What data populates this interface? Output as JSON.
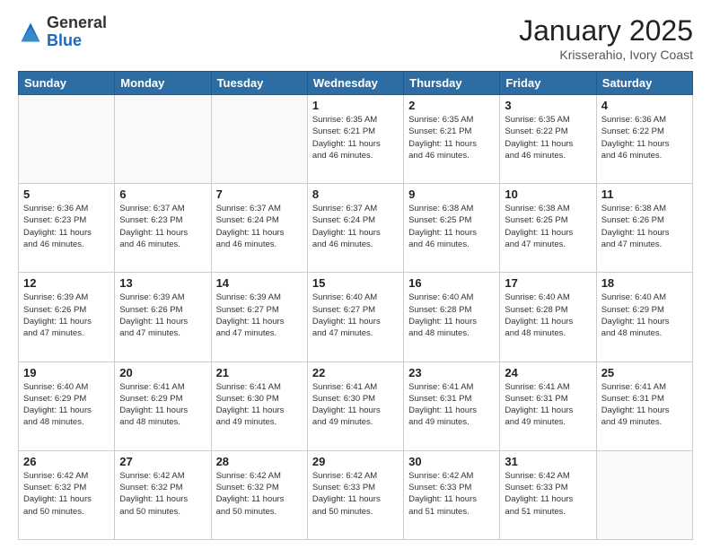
{
  "logo": {
    "general": "General",
    "blue": "Blue"
  },
  "header": {
    "month": "January 2025",
    "location": "Krisserahio, Ivory Coast"
  },
  "weekdays": [
    "Sunday",
    "Monday",
    "Tuesday",
    "Wednesday",
    "Thursday",
    "Friday",
    "Saturday"
  ],
  "weeks": [
    [
      {
        "day": "",
        "info": ""
      },
      {
        "day": "",
        "info": ""
      },
      {
        "day": "",
        "info": ""
      },
      {
        "day": "1",
        "info": "Sunrise: 6:35 AM\nSunset: 6:21 PM\nDaylight: 11 hours\nand 46 minutes."
      },
      {
        "day": "2",
        "info": "Sunrise: 6:35 AM\nSunset: 6:21 PM\nDaylight: 11 hours\nand 46 minutes."
      },
      {
        "day": "3",
        "info": "Sunrise: 6:35 AM\nSunset: 6:22 PM\nDaylight: 11 hours\nand 46 minutes."
      },
      {
        "day": "4",
        "info": "Sunrise: 6:36 AM\nSunset: 6:22 PM\nDaylight: 11 hours\nand 46 minutes."
      }
    ],
    [
      {
        "day": "5",
        "info": "Sunrise: 6:36 AM\nSunset: 6:23 PM\nDaylight: 11 hours\nand 46 minutes."
      },
      {
        "day": "6",
        "info": "Sunrise: 6:37 AM\nSunset: 6:23 PM\nDaylight: 11 hours\nand 46 minutes."
      },
      {
        "day": "7",
        "info": "Sunrise: 6:37 AM\nSunset: 6:24 PM\nDaylight: 11 hours\nand 46 minutes."
      },
      {
        "day": "8",
        "info": "Sunrise: 6:37 AM\nSunset: 6:24 PM\nDaylight: 11 hours\nand 46 minutes."
      },
      {
        "day": "9",
        "info": "Sunrise: 6:38 AM\nSunset: 6:25 PM\nDaylight: 11 hours\nand 46 minutes."
      },
      {
        "day": "10",
        "info": "Sunrise: 6:38 AM\nSunset: 6:25 PM\nDaylight: 11 hours\nand 47 minutes."
      },
      {
        "day": "11",
        "info": "Sunrise: 6:38 AM\nSunset: 6:26 PM\nDaylight: 11 hours\nand 47 minutes."
      }
    ],
    [
      {
        "day": "12",
        "info": "Sunrise: 6:39 AM\nSunset: 6:26 PM\nDaylight: 11 hours\nand 47 minutes."
      },
      {
        "day": "13",
        "info": "Sunrise: 6:39 AM\nSunset: 6:26 PM\nDaylight: 11 hours\nand 47 minutes."
      },
      {
        "day": "14",
        "info": "Sunrise: 6:39 AM\nSunset: 6:27 PM\nDaylight: 11 hours\nand 47 minutes."
      },
      {
        "day": "15",
        "info": "Sunrise: 6:40 AM\nSunset: 6:27 PM\nDaylight: 11 hours\nand 47 minutes."
      },
      {
        "day": "16",
        "info": "Sunrise: 6:40 AM\nSunset: 6:28 PM\nDaylight: 11 hours\nand 48 minutes."
      },
      {
        "day": "17",
        "info": "Sunrise: 6:40 AM\nSunset: 6:28 PM\nDaylight: 11 hours\nand 48 minutes."
      },
      {
        "day": "18",
        "info": "Sunrise: 6:40 AM\nSunset: 6:29 PM\nDaylight: 11 hours\nand 48 minutes."
      }
    ],
    [
      {
        "day": "19",
        "info": "Sunrise: 6:40 AM\nSunset: 6:29 PM\nDaylight: 11 hours\nand 48 minutes."
      },
      {
        "day": "20",
        "info": "Sunrise: 6:41 AM\nSunset: 6:29 PM\nDaylight: 11 hours\nand 48 minutes."
      },
      {
        "day": "21",
        "info": "Sunrise: 6:41 AM\nSunset: 6:30 PM\nDaylight: 11 hours\nand 49 minutes."
      },
      {
        "day": "22",
        "info": "Sunrise: 6:41 AM\nSunset: 6:30 PM\nDaylight: 11 hours\nand 49 minutes."
      },
      {
        "day": "23",
        "info": "Sunrise: 6:41 AM\nSunset: 6:31 PM\nDaylight: 11 hours\nand 49 minutes."
      },
      {
        "day": "24",
        "info": "Sunrise: 6:41 AM\nSunset: 6:31 PM\nDaylight: 11 hours\nand 49 minutes."
      },
      {
        "day": "25",
        "info": "Sunrise: 6:41 AM\nSunset: 6:31 PM\nDaylight: 11 hours\nand 49 minutes."
      }
    ],
    [
      {
        "day": "26",
        "info": "Sunrise: 6:42 AM\nSunset: 6:32 PM\nDaylight: 11 hours\nand 50 minutes."
      },
      {
        "day": "27",
        "info": "Sunrise: 6:42 AM\nSunset: 6:32 PM\nDaylight: 11 hours\nand 50 minutes."
      },
      {
        "day": "28",
        "info": "Sunrise: 6:42 AM\nSunset: 6:32 PM\nDaylight: 11 hours\nand 50 minutes."
      },
      {
        "day": "29",
        "info": "Sunrise: 6:42 AM\nSunset: 6:33 PM\nDaylight: 11 hours\nand 50 minutes."
      },
      {
        "day": "30",
        "info": "Sunrise: 6:42 AM\nSunset: 6:33 PM\nDaylight: 11 hours\nand 51 minutes."
      },
      {
        "day": "31",
        "info": "Sunrise: 6:42 AM\nSunset: 6:33 PM\nDaylight: 11 hours\nand 51 minutes."
      },
      {
        "day": "",
        "info": ""
      }
    ]
  ]
}
